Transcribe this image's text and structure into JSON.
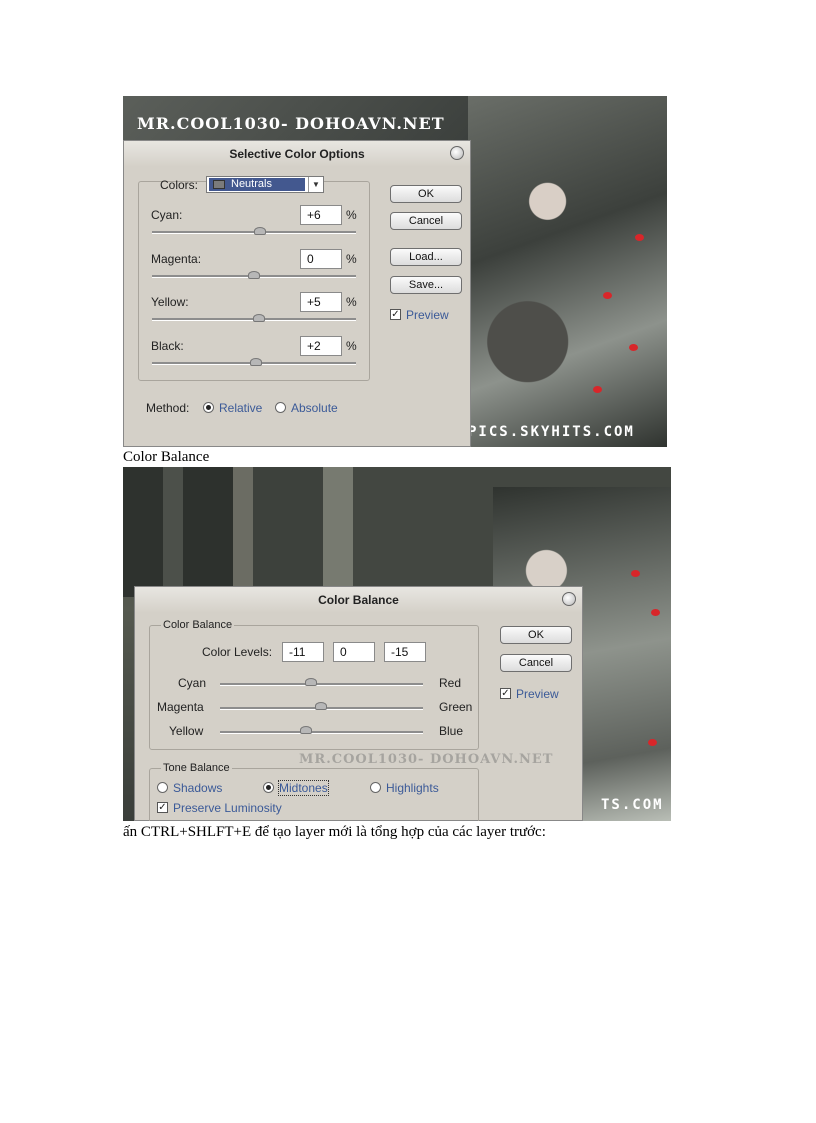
{
  "shot1": {
    "watermark_top": "MR.COOL1030- DOHOAVN.NET",
    "watermark_bottom": "PICS.SKYHITS.COM",
    "dialog": {
      "title": "Selective Color Options",
      "colors_label": "Colors:",
      "colors_value": "Neutrals",
      "sliders": [
        {
          "label": "Cyan:",
          "value": "+6",
          "unit": "%"
        },
        {
          "label": "Magenta:",
          "value": "0",
          "unit": "%"
        },
        {
          "label": "Yellow:",
          "value": "+5",
          "unit": "%"
        },
        {
          "label": "Black:",
          "value": "+2",
          "unit": "%"
        }
      ],
      "buttons": {
        "ok": "OK",
        "cancel": "Cancel",
        "load": "Load...",
        "save": "Save..."
      },
      "preview_label": "Preview",
      "preview_checked": true,
      "method_label": "Method:",
      "method_options": [
        "Relative",
        "Absolute"
      ],
      "method_selected": "Relative"
    }
  },
  "caption1": "Color Balance",
  "shot2": {
    "watermark_mid": "MR.COOL1030- DOHOAVN.NET",
    "watermark_bottom": "TS.COM",
    "dialog": {
      "title": "Color Balance",
      "group_color_balance": "Color Balance",
      "levels_label": "Color Levels:",
      "levels": [
        "-11",
        "0",
        "-15"
      ],
      "sliders": [
        {
          "left": "Cyan",
          "right": "Red"
        },
        {
          "left": "Magenta",
          "right": "Green"
        },
        {
          "left": "Yellow",
          "right": "Blue"
        }
      ],
      "group_tone_balance": "Tone Balance",
      "tones": [
        "Shadows",
        "Midtones",
        "Highlights"
      ],
      "tone_selected": "Midtones",
      "preserve_label": "Preserve Luminosity",
      "preserve_checked": true,
      "buttons": {
        "ok": "OK",
        "cancel": "Cancel"
      },
      "preview_label": "Preview",
      "preview_checked": true
    }
  },
  "caption2": "ấn CTRL+SHLFT+E  để tạo layer mới là tổng hợp của các layer trước:"
}
